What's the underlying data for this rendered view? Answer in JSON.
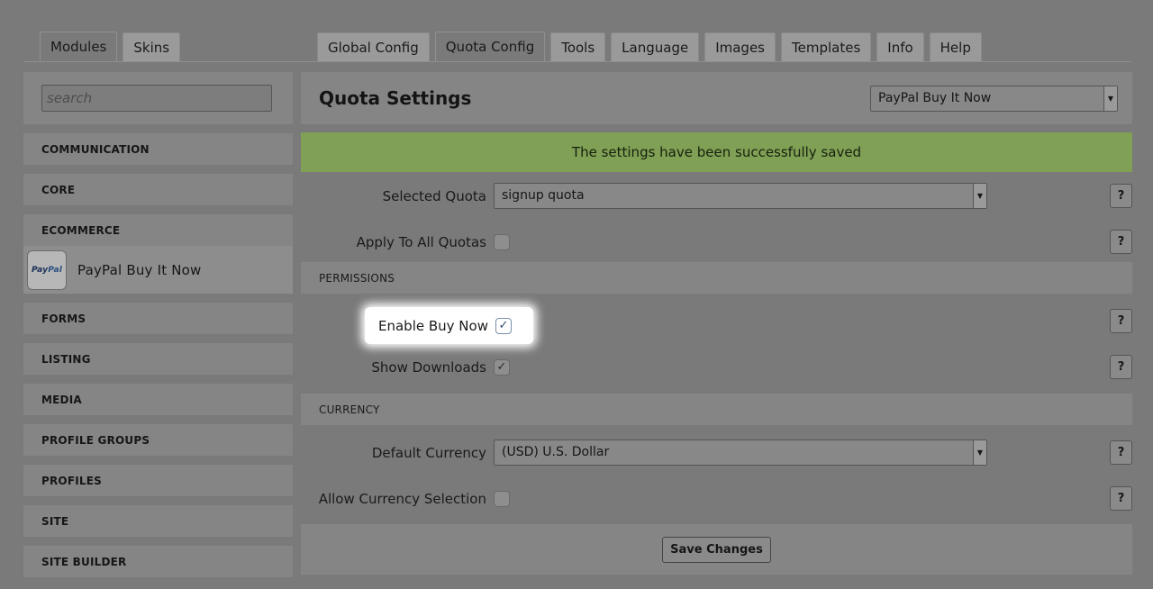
{
  "left_tabs": [
    {
      "label": "Modules",
      "active": true
    },
    {
      "label": "Skins",
      "active": false
    }
  ],
  "right_tabs": [
    {
      "label": "Global Config",
      "active": false
    },
    {
      "label": "Quota Config",
      "active": true
    },
    {
      "label": "Tools",
      "active": false
    },
    {
      "label": "Language",
      "active": false
    },
    {
      "label": "Images",
      "active": false
    },
    {
      "label": "Templates",
      "active": false
    },
    {
      "label": "Info",
      "active": false
    },
    {
      "label": "Help",
      "active": false
    }
  ],
  "sidebar": {
    "search_placeholder": "search",
    "categories": [
      "COMMUNICATION",
      "CORE",
      "ECOMMERCE",
      "PayPal Buy It Now",
      "FORMS",
      "LISTING",
      "MEDIA",
      "PROFILE GROUPS",
      "PROFILES",
      "SITE",
      "SITE BUILDER"
    ],
    "active_module": "PayPal Buy It Now",
    "active_logo": {
      "text_pay": "Pay",
      "text_pal": "Pal"
    }
  },
  "main": {
    "title": "Quota Settings",
    "module_select": "PayPal Buy It Now",
    "notice": "The settings have been successfully saved",
    "selected_quota_label": "Selected Quota",
    "selected_quota_value": "signup quota",
    "apply_all_label": "Apply To All Quotas",
    "apply_all_checked": false,
    "permissions_header": "PERMISSIONS",
    "enable_buy_now_label": "Enable Buy Now",
    "enable_buy_now_checked": true,
    "show_downloads_label": "Show Downloads",
    "show_downloads_checked": true,
    "currency_header": "CURRENCY",
    "default_currency_label": "Default Currency",
    "default_currency_value": "(USD) U.S. Dollar",
    "allow_currency_label": "Allow Currency Selection",
    "allow_currency_checked": false,
    "help_symbol": "?",
    "check_symbol": "✓",
    "save_label": "Save Changes"
  }
}
